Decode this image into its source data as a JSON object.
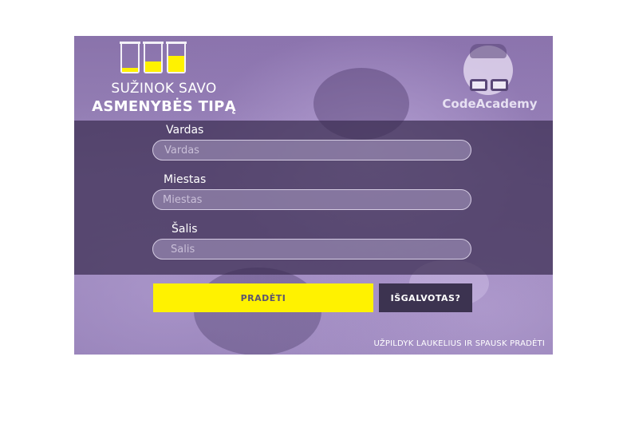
{
  "header": {
    "title_line1": "SUŽINOK SAVO",
    "title_line2": "ASMENYBĖS TIPĄ",
    "glass_levels": [
      0.15,
      0.35,
      0.55
    ],
    "glass_icon": "glass-icon"
  },
  "brand": {
    "name": "CodeAcademy",
    "icon": "nerd-face-icon"
  },
  "form": {
    "fields": [
      {
        "label": "Vardas",
        "placeholder": "Vardas",
        "value": ""
      },
      {
        "label": "Miestas",
        "placeholder": "Miestas",
        "value": ""
      },
      {
        "label": "Šalis",
        "placeholder": "Šalis",
        "value": ""
      }
    ]
  },
  "actions": {
    "start_label": "PRADĖTI",
    "thought_label": "IŠGALVOTAS?"
  },
  "footer": {
    "hint": "UŽPILDYK LAUKELIUS IR SPAUSK PRADĖTI"
  },
  "colors": {
    "accent": "#fff200",
    "panel": "#3a2c50",
    "background": "#8a73ab"
  }
}
